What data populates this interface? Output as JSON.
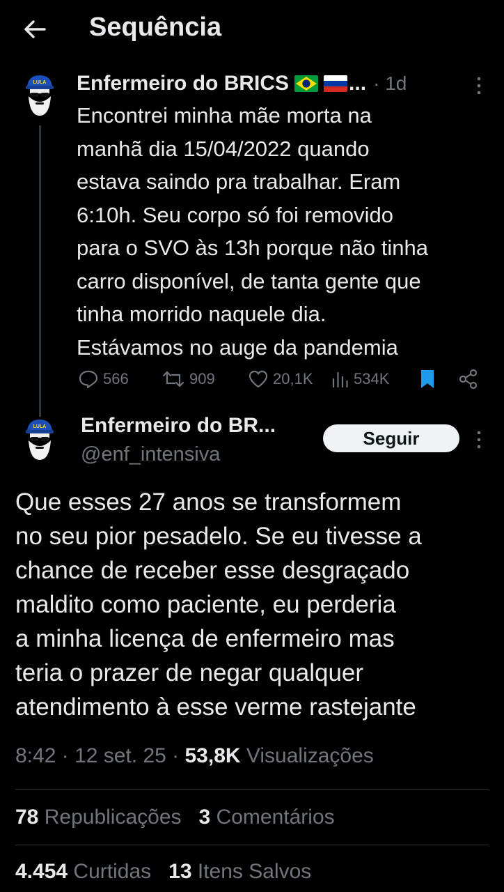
{
  "header": {
    "title": "Sequência"
  },
  "tweet1": {
    "author_name": "Enfermeiro do BRICS",
    "ellipsis": "...",
    "time": "· 1d",
    "text": "Encontrei minha mãe morta na\nmanhã dia 15/04/2022 quando\nestava saindo pra trabalhar. Eram\n6:10h.  Seu corpo só foi removido\npara o SVO às 13h porque não tinha\ncarro disponível, de tanta gente que\ntinha morrido naquele dia.\nEstávamos no auge da pandemia",
    "replies": "566",
    "reposts": "909",
    "likes": "20,1K",
    "views": "534K",
    "avatar_cap_text": "LULA"
  },
  "tweet2": {
    "author_name": "Enfermeiro do BR...",
    "handle": "@enf_intensiva",
    "follow_label": "Seguir",
    "avatar_cap_text": "LULA",
    "text": "Que esses 27 anos se transformem\nno seu pior pesadelo. Se eu tivesse a\nchance de receber esse desgraçado\nmaldito como paciente, eu perderia\na minha licença de enfermeiro mas\nteria o prazer de negar qualquer\natendimento à esse verme rastejante",
    "time": "8:42",
    "date": "12 set. 25",
    "views_count": "53,8K",
    "views_label": "Visualizações",
    "reposts_count": "78",
    "reposts_label": "Republicações",
    "comments_count": "3",
    "comments_label": "Comentários",
    "likes_count": "4.454",
    "likes_label": "Curtidas",
    "saves_count": "13",
    "saves_label": "Itens Salvos"
  },
  "colors": {
    "background": "#000000",
    "text": "#e7e9ea",
    "muted": "#71767b",
    "bookmark": "#1d9bf0",
    "divider": "#2f3336"
  }
}
